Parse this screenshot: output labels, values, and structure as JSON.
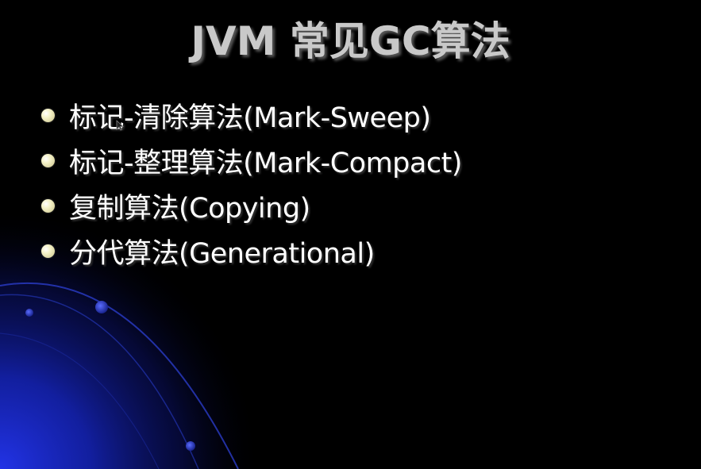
{
  "slide": {
    "title": "JVM 常见GC算法",
    "bullets": [
      "标记-清除算法(Mark-Sweep)",
      "标记-整理算法(Mark-Compact)",
      "复制算法(Copying)",
      "分代算法(Generational)"
    ],
    "colors": {
      "background": "#000000",
      "title": "#c9c9c9",
      "text": "#ffffff",
      "accent_glow": "#1a2fd8"
    }
  }
}
